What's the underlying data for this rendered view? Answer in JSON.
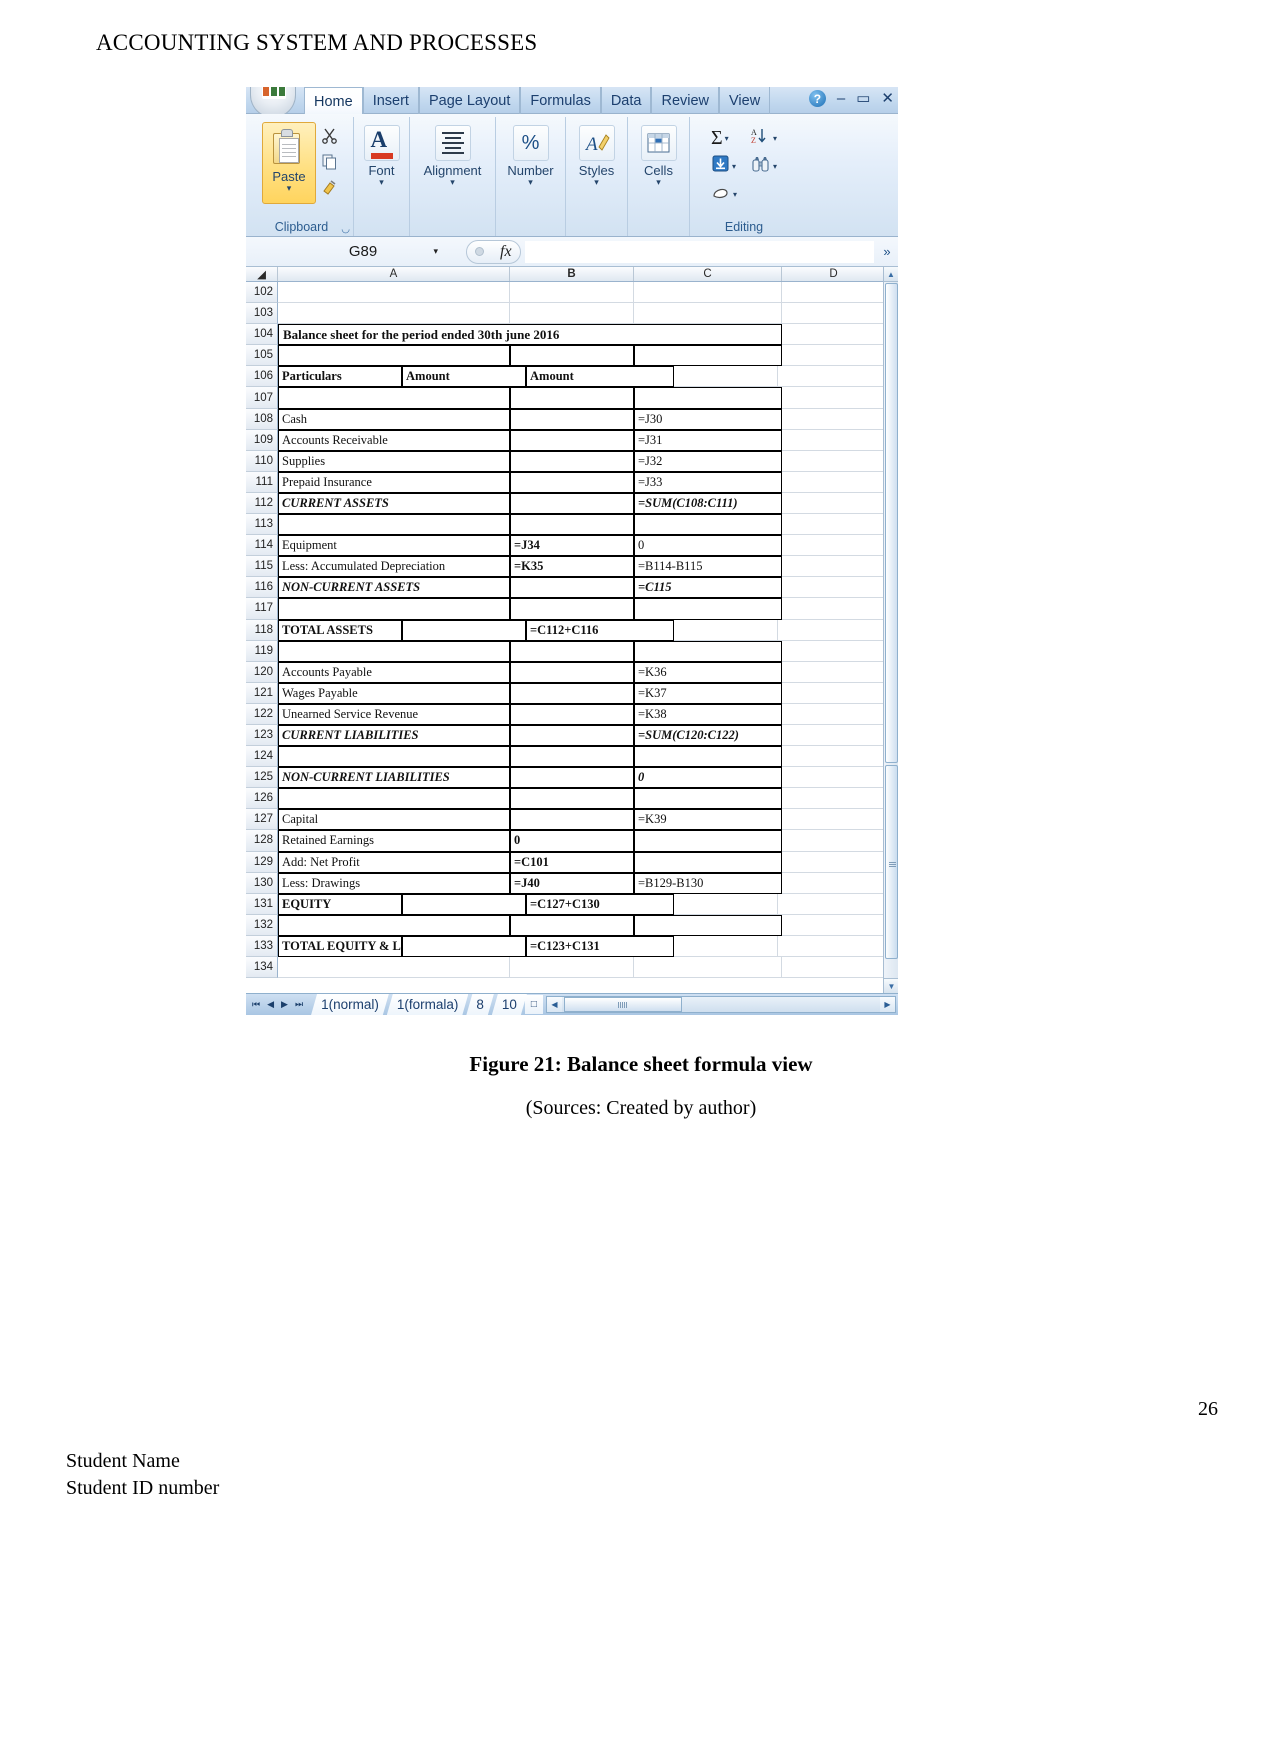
{
  "document": {
    "header": "ACCOUNTING SYSTEM AND PROCESSES",
    "figure_caption": "Figure 21: Balance sheet formula view",
    "figure_source": "(Sources: Created by author)",
    "page_number": "26",
    "footer_line1": "Student Name",
    "footer_line2": "Student ID number"
  },
  "excel": {
    "ribbon_tabs": [
      {
        "label": "Home",
        "active": true
      },
      {
        "label": "Insert",
        "active": false
      },
      {
        "label": "Page Layout",
        "active": false
      },
      {
        "label": "Formulas",
        "active": false
      },
      {
        "label": "Data",
        "active": false
      },
      {
        "label": "Review",
        "active": false
      },
      {
        "label": "View",
        "active": false
      }
    ],
    "window_controls": {
      "help": "?",
      "minimize": "–",
      "restore": "▭",
      "close": "✕"
    },
    "groups": {
      "clipboard": {
        "label": "Clipboard",
        "paste": "Paste",
        "caret": "▾"
      },
      "font": {
        "label": "Font",
        "caret": "▾"
      },
      "alignment": {
        "label": "Alignment",
        "caret": "▾"
      },
      "number": {
        "label": "Number",
        "glyph": "%",
        "caret": "▾"
      },
      "styles": {
        "label": "Styles",
        "caret": "▾"
      },
      "cells": {
        "label": "Cells",
        "caret": "▾"
      },
      "editing": {
        "label": "Editing",
        "autosum": "Σ",
        "sort": "A↓Z",
        "fill": "⬇",
        "find": "🔎",
        "clear": "◳",
        "caret": "▾"
      }
    },
    "formula_bar": {
      "name_box": "G89",
      "name_box_caret": "▾",
      "fx": "fx",
      "formula_value": "",
      "expand_caret": "»"
    },
    "column_headers": [
      "A",
      "B",
      "C",
      "D"
    ],
    "sheet_tabs": [
      {
        "label": "1(normal)",
        "active": false
      },
      {
        "label": "1(formala)",
        "active": false
      },
      {
        "label": "8",
        "active": false
      },
      {
        "label": "10",
        "active": false
      }
    ],
    "nav_buttons": [
      "⏮",
      "◀",
      "▶",
      "⏭"
    ],
    "rows": [
      {
        "n": "102",
        "a": "",
        "b": "",
        "c": "",
        "d": "",
        "style": "plain"
      },
      {
        "n": "103",
        "a": "",
        "b": "",
        "c": "",
        "d": "",
        "style": "plain"
      },
      {
        "n": "104",
        "a": "Balance sheet for the period ended 30th june 2016",
        "b": "",
        "c": "",
        "d": "",
        "style": "title"
      },
      {
        "n": "105",
        "a": "",
        "b": "",
        "c": "",
        "d": "",
        "style": "boxed"
      },
      {
        "n": "106",
        "a": "Particulars",
        "b": "Amount",
        "c": "Amount",
        "d": "",
        "style": "boxed-bold"
      },
      {
        "n": "107",
        "a": "",
        "b": "",
        "c": "",
        "d": "",
        "style": "boxed"
      },
      {
        "n": "108",
        "a": "Cash",
        "b": "",
        "c": "=J30",
        "d": "",
        "style": "boxed"
      },
      {
        "n": "109",
        "a": "Accounts Receivable",
        "b": "",
        "c": "=J31",
        "d": "",
        "style": "boxed"
      },
      {
        "n": "110",
        "a": "Supplies",
        "b": "",
        "c": "=J32",
        "d": "",
        "style": "boxed"
      },
      {
        "n": "111",
        "a": "Prepaid Insurance",
        "b": "",
        "c": "=J33",
        "d": "",
        "style": "boxed"
      },
      {
        "n": "112",
        "a": "CURRENT ASSETS",
        "b": "",
        "c": "=SUM(C108:C111)",
        "d": "",
        "style": "boxed-italic"
      },
      {
        "n": "113",
        "a": "",
        "b": "",
        "c": "",
        "d": "",
        "style": "boxed"
      },
      {
        "n": "114",
        "a": "Equipment",
        "b": "=J34",
        "c": "0",
        "d": "",
        "style": "boxed"
      },
      {
        "n": "115",
        "a": "Less: Accumulated Depreciation",
        "b": "=K35",
        "c": "=B114-B115",
        "d": "",
        "style": "boxed"
      },
      {
        "n": "116",
        "a": "NON-CURRENT ASSETS",
        "b": "",
        "c": "=C115",
        "d": "",
        "style": "boxed-italic"
      },
      {
        "n": "117",
        "a": "",
        "b": "",
        "c": "",
        "d": "",
        "style": "boxed"
      },
      {
        "n": "118",
        "a": "TOTAL ASSETS",
        "b": "",
        "c": "=C112+C116",
        "d": "",
        "style": "boxed-bold"
      },
      {
        "n": "119",
        "a": "",
        "b": "",
        "c": "",
        "d": "",
        "style": "boxed"
      },
      {
        "n": "120",
        "a": "Accounts Payable",
        "b": "",
        "c": "=K36",
        "d": "",
        "style": "boxed"
      },
      {
        "n": "121",
        "a": "Wages Payable",
        "b": "",
        "c": "=K37",
        "d": "",
        "style": "boxed"
      },
      {
        "n": "122",
        "a": "Unearned Service Revenue",
        "b": "",
        "c": "=K38",
        "d": "",
        "style": "boxed"
      },
      {
        "n": "123",
        "a": "CURRENT LIABILITIES",
        "b": "",
        "c": "=SUM(C120:C122)",
        "d": "",
        "style": "boxed-italic"
      },
      {
        "n": "124",
        "a": "",
        "b": "",
        "c": "",
        "d": "",
        "style": "boxed"
      },
      {
        "n": "125",
        "a": "NON-CURRENT LIABILITIES",
        "b": "",
        "c": "0",
        "d": "",
        "style": "boxed-italic"
      },
      {
        "n": "126",
        "a": "",
        "b": "",
        "c": "",
        "d": "",
        "style": "boxed"
      },
      {
        "n": "127",
        "a": "Capital",
        "b": "",
        "c": "=K39",
        "d": "",
        "style": "boxed"
      },
      {
        "n": "128",
        "a": "Retained Earnings",
        "b": "0",
        "c": "",
        "d": "",
        "style": "boxed"
      },
      {
        "n": "129",
        "a": "Add: Net Profit",
        "b": "=C101",
        "c": "",
        "d": "",
        "style": "boxed"
      },
      {
        "n": "130",
        "a": "Less: Drawings",
        "b": "=J40",
        "c": "=B129-B130",
        "d": "",
        "style": "boxed"
      },
      {
        "n": "131",
        "a": "EQUITY",
        "b": "",
        "c": "=C127+C130",
        "d": "",
        "style": "boxed-bold"
      },
      {
        "n": "132",
        "a": "",
        "b": "",
        "c": "",
        "d": "",
        "style": "boxed"
      },
      {
        "n": "133",
        "a": "TOTAL EQUITY & LIABILITY",
        "b": "",
        "c": "=C123+C131",
        "d": "",
        "style": "boxed-bold"
      },
      {
        "n": "134",
        "a": "",
        "b": "",
        "c": "",
        "d": "",
        "style": "plain"
      }
    ]
  }
}
